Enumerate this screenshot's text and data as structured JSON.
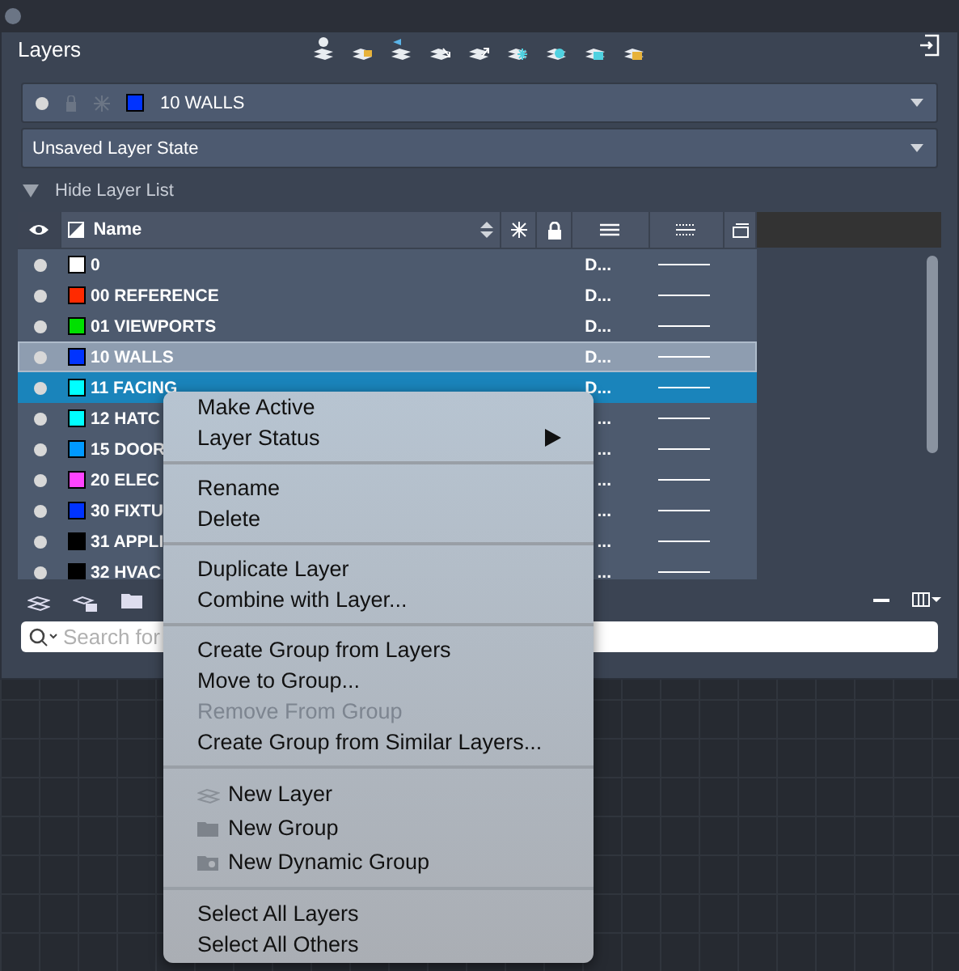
{
  "panel": {
    "title": "Layers"
  },
  "current_layer": {
    "name": "10 WALLS",
    "color": "#0033ff"
  },
  "layer_state": {
    "value": "Unsaved Layer State"
  },
  "list_toggle": {
    "label": "Hide Layer List",
    "expanded": true
  },
  "table": {
    "columns": [
      {
        "label": "Name"
      }
    ],
    "rows": [
      {
        "name": "0",
        "color": "#ffffff",
        "lineweight": "D...",
        "on": true,
        "current": false,
        "selected": false
      },
      {
        "name": "00 REFERENCE",
        "color": "#ff2a00",
        "lineweight": "D...",
        "on": true,
        "current": false,
        "selected": false
      },
      {
        "name": "01 VIEWPORTS",
        "color": "#00e000",
        "lineweight": "D...",
        "on": true,
        "current": false,
        "selected": false
      },
      {
        "name": "10 WALLS",
        "color": "#0033ff",
        "lineweight": "D...",
        "on": true,
        "current": true,
        "selected": false
      },
      {
        "name": "11 FACING",
        "color": "#00ffff",
        "lineweight": "D...",
        "on": true,
        "current": false,
        "selected": true
      },
      {
        "name": "12 HATC",
        "color": "#00ffff",
        "lineweight": "...",
        "on": true,
        "current": false,
        "selected": false
      },
      {
        "name": "15 DOOR",
        "color": "#0099ff",
        "lineweight": "...",
        "on": true,
        "current": false,
        "selected": false
      },
      {
        "name": "20 ELEC",
        "color": "#ff44ff",
        "lineweight": "...",
        "on": true,
        "current": false,
        "selected": false
      },
      {
        "name": "30 FIXTU",
        "color": "#0033ff",
        "lineweight": "...",
        "on": true,
        "current": false,
        "selected": false
      },
      {
        "name": "31 APPLI",
        "color": "#000000",
        "lineweight": "...",
        "on": true,
        "current": false,
        "selected": false
      },
      {
        "name": "32 HVAC",
        "color": "#000000",
        "lineweight": "...",
        "on": true,
        "current": false,
        "selected": false
      }
    ]
  },
  "search": {
    "placeholder": "Search for"
  },
  "context_menu": {
    "groups": [
      [
        {
          "label": "Make Active",
          "submenu": false,
          "disabled": false
        },
        {
          "label": "Layer Status",
          "submenu": true,
          "disabled": false
        }
      ],
      [
        {
          "label": "Rename",
          "submenu": false,
          "disabled": false
        },
        {
          "label": "Delete",
          "submenu": false,
          "disabled": false
        }
      ],
      [
        {
          "label": "Duplicate Layer",
          "submenu": false,
          "disabled": false
        },
        {
          "label": "Combine with Layer...",
          "submenu": false,
          "disabled": false
        }
      ],
      [
        {
          "label": "Create Group from Layers",
          "submenu": false,
          "disabled": false
        },
        {
          "label": "Move to Group...",
          "submenu": false,
          "disabled": false
        },
        {
          "label": "Remove From Group",
          "submenu": false,
          "disabled": true
        },
        {
          "label": "Create Group from Similar Layers...",
          "submenu": false,
          "disabled": false
        }
      ],
      [
        {
          "label": "New Layer",
          "submenu": false,
          "disabled": false,
          "kind": "layer"
        },
        {
          "label": "New Group",
          "submenu": false,
          "disabled": false,
          "kind": "folder"
        },
        {
          "label": "New Dynamic Group",
          "submenu": false,
          "disabled": false,
          "kind": "dynamic-folder"
        }
      ],
      [
        {
          "label": "Select All Layers",
          "submenu": false,
          "disabled": false
        },
        {
          "label": "Select All Others",
          "submenu": false,
          "disabled": false
        }
      ]
    ]
  }
}
